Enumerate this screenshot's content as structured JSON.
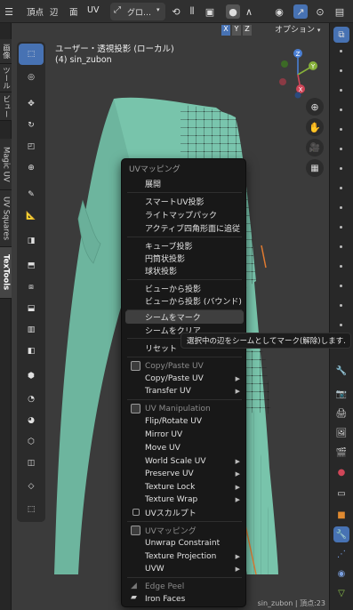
{
  "header": {
    "menu_items": [
      "頂点",
      "辺",
      "面",
      "UV"
    ],
    "transform_orientation": "グロ…",
    "options_label": "オプション",
    "axis_buttons": [
      "X",
      "Y",
      "Z"
    ]
  },
  "left_tabs": [
    "画像",
    "ツール",
    "ビュー",
    "Magic UV",
    "UV Squares",
    "TexTools"
  ],
  "viewport": {
    "title": "ユーザー・透視投影 (ローカル)",
    "object_label": "(4) sin_zubon",
    "gizmo_axes": [
      "Z",
      "Y",
      "X"
    ]
  },
  "menu": {
    "title": "UVマッピング",
    "items": [
      {
        "label": "展開"
      },
      {
        "label": "スマートUV投影"
      },
      {
        "label": "ライトマップパック"
      },
      {
        "label": "アクティブ四角形面に追従"
      },
      {
        "label": "キューブ投影"
      },
      {
        "label": "円筒状投影"
      },
      {
        "label": "球状投影"
      },
      {
        "label": "ビューから投影"
      },
      {
        "label": "ビューから投影 (バウンド)"
      },
      {
        "label": "シームをマーク"
      },
      {
        "label": "シームをクリア"
      },
      {
        "label": "リセット"
      }
    ],
    "sections": [
      {
        "title": "Copy/Paste UV",
        "items": [
          {
            "label": "Copy/Paste UV",
            "submenu": true
          },
          {
            "label": "Transfer UV",
            "submenu": true
          }
        ]
      },
      {
        "title": "UV Manipulation",
        "items": [
          {
            "label": "Flip/Rotate UV"
          },
          {
            "label": "Mirror UV"
          },
          {
            "label": "Move UV"
          },
          {
            "label": "World Scale UV",
            "submenu": true
          },
          {
            "label": "Preserve UV",
            "submenu": true
          },
          {
            "label": "Texture Lock",
            "submenu": true
          },
          {
            "label": "Texture Wrap",
            "submenu": true
          },
          {
            "label": "UVスカルプト"
          }
        ]
      },
      {
        "title": "UVマッピング",
        "items": [
          {
            "label": "Unwrap Constraint"
          },
          {
            "label": "Texture Projection",
            "submenu": true
          },
          {
            "label": "UVW",
            "submenu": true
          }
        ]
      }
    ],
    "extra": [
      "Edge Peel",
      "Iron Faces"
    ]
  },
  "tooltip": "選択中の辺をシームとしてマーク(解除)します.",
  "status_text": "sin_zubon | 頂点:23",
  "colors": {
    "accent": "#4772b3",
    "mesh": "#78c4ab",
    "menu_bg": "#181818",
    "highlight": "#3f3f3f"
  }
}
